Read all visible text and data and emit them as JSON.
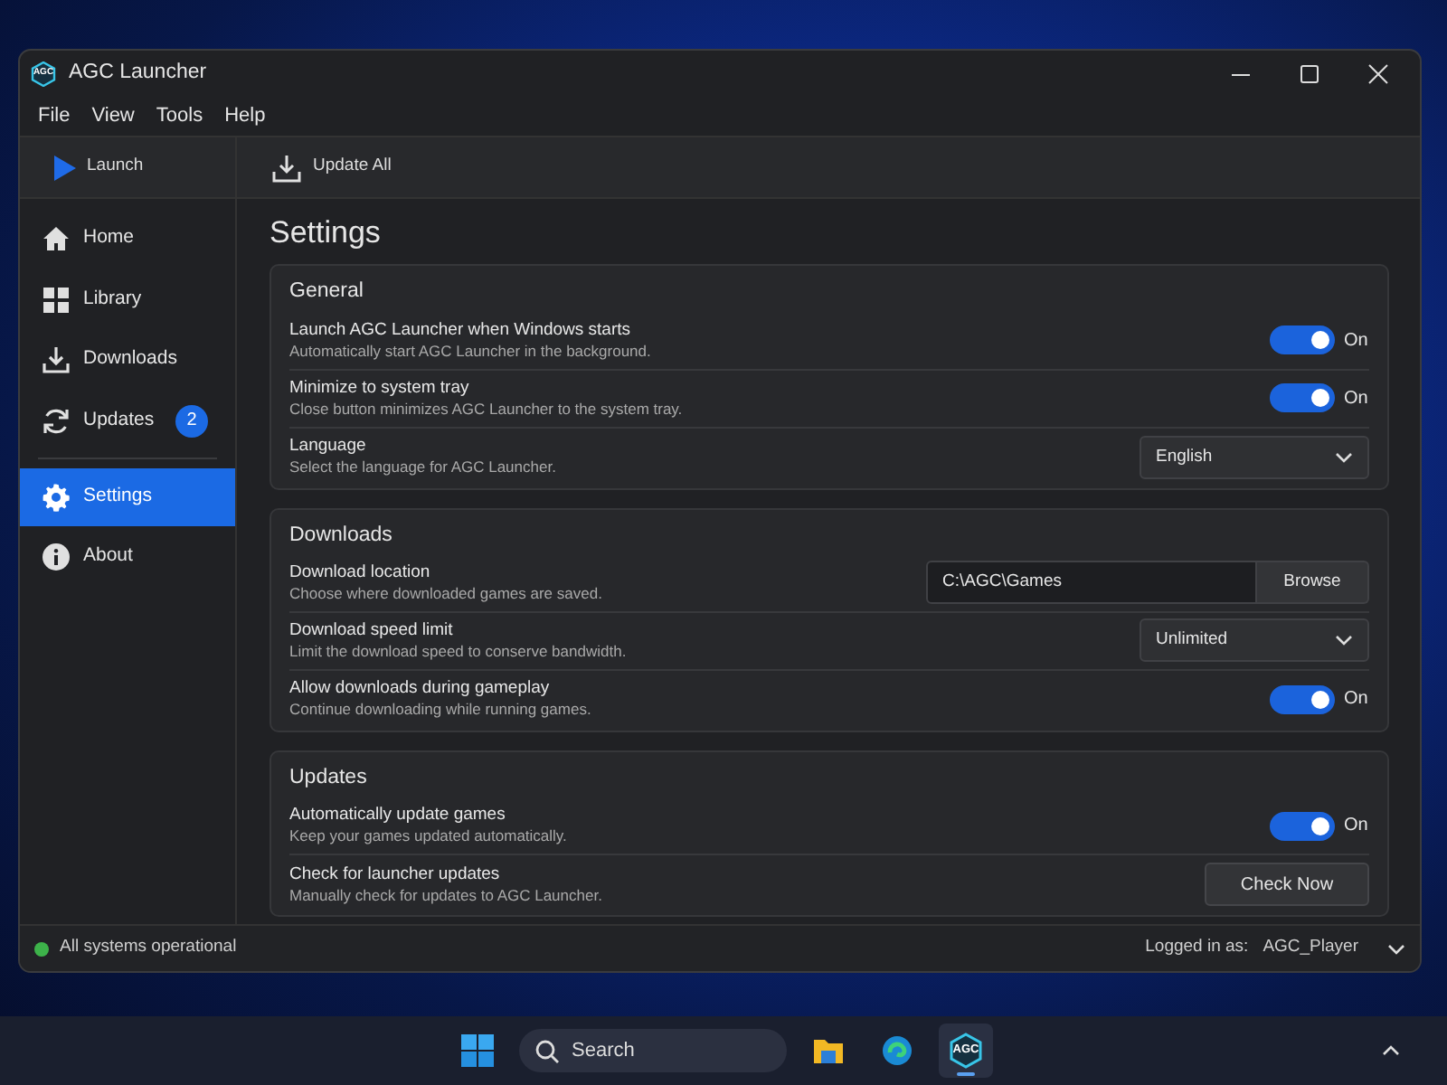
{
  "window": {
    "title": "AGC Launcher",
    "logo_text": "AGC"
  },
  "menu": [
    "File",
    "View",
    "Tools",
    "Help"
  ],
  "toolbar": {
    "sidebar_action": "Launch",
    "main_action": "Update All"
  },
  "sidebar": {
    "groups": [
      [
        {
          "kind": "home",
          "label": "Home",
          "selected": false
        },
        {
          "kind": "library",
          "label": "Library",
          "selected": false
        },
        {
          "kind": "downloads",
          "label": "Downloads",
          "selected": false
        },
        {
          "kind": "updates",
          "label": "Updates",
          "selected": false,
          "badge": "2"
        }
      ],
      [
        {
          "kind": "settings",
          "label": "Settings",
          "selected": true
        },
        {
          "kind": "about",
          "label": "About",
          "selected": false
        }
      ]
    ]
  },
  "page_title": "Settings",
  "sections": [
    {
      "title": "General",
      "rows": [
        {
          "kind": "toggle",
          "label": "Launch AGC Launcher when Windows starts",
          "description": "Automatically start AGC Launcher in the background.",
          "on": true,
          "state_label": "On"
        },
        {
          "kind": "toggle",
          "label": "Minimize to system tray",
          "description": "Close button minimizes AGC Launcher to the system tray.",
          "on": true,
          "state_label": "On"
        },
        {
          "kind": "select",
          "label": "Language",
          "description": "Select the language for AGC Launcher.",
          "value": "English"
        }
      ]
    },
    {
      "title": "Downloads",
      "rows": [
        {
          "kind": "path",
          "label": "Download location",
          "description": "Choose where downloaded games are saved.",
          "value": "C:\\AGC\\Games",
          "button": "Browse"
        },
        {
          "kind": "select",
          "label": "Download speed limit",
          "description": "Limit the download speed to conserve bandwidth.",
          "value": "Unlimited"
        },
        {
          "kind": "toggle",
          "label": "Allow downloads during gameplay",
          "description": "Continue downloading while running games.",
          "on": true,
          "state_label": "On"
        }
      ]
    },
    {
      "title": "Updates",
      "rows": [
        {
          "kind": "toggle",
          "label": "Automatically update games",
          "description": "Keep your games updated automatically.",
          "on": true,
          "state_label": "On"
        },
        {
          "kind": "button",
          "label": "Check for launcher updates",
          "description": "Manually check for updates to AGC Launcher.",
          "button": "Check Now"
        }
      ]
    }
  ],
  "status_bar": {
    "status": "All systems operational",
    "logged_in_label": "Logged in as:",
    "user": "AGC_Player"
  },
  "taskbar": {
    "search_placeholder": "Search",
    "apps": [
      {
        "kind": "folder",
        "selected": false
      },
      {
        "kind": "browser",
        "selected": false
      },
      {
        "kind": "agc",
        "selected": true,
        "label": "AGC"
      }
    ]
  }
}
